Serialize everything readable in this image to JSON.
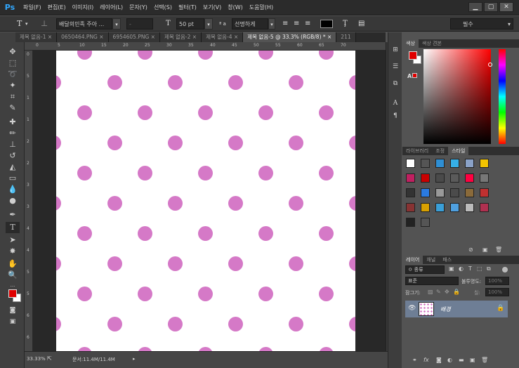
{
  "app": {
    "logo": "Ps",
    "window_controls": [
      "▁",
      "▢",
      "✕"
    ]
  },
  "menu": [
    "파일(F)",
    "편집(E)",
    "이미지(I)",
    "레이어(L)",
    "문자(Y)",
    "선택(S)",
    "필터(T)",
    "보기(V)",
    "창(W)",
    "도움말(H)"
  ],
  "options": {
    "font_family": "배달의민족 주아 ...",
    "font_style": "-",
    "font_size": "50 pt",
    "aa_label": "ª a",
    "anti_alias": "선명하게",
    "workspace": "필수",
    "text_color": "#000000"
  },
  "tabs": [
    {
      "label": "제목 없음-1 ×",
      "active": false
    },
    {
      "label": "0650464.PNG ×",
      "active": false
    },
    {
      "label": "6954605.PNG ×",
      "active": false
    },
    {
      "label": "제목 없음-2 ×",
      "active": false
    },
    {
      "label": "제목 없음-4 ×",
      "active": false
    },
    {
      "label": "제목 없음-5 @ 33.3% (RGB/8) * ×",
      "active": true
    },
    {
      "label": "211",
      "active": false
    }
  ],
  "ruler_h": [
    "0",
    "5",
    "10",
    "15",
    "20",
    "25",
    "30",
    "35",
    "40",
    "45",
    "50",
    "55",
    "60",
    "65",
    "70"
  ],
  "ruler_v": [
    "0",
    "5",
    "1",
    "1",
    "2",
    "2",
    "3",
    "3",
    "4",
    "4",
    "5",
    "5",
    "6",
    "6",
    "7"
  ],
  "status": {
    "zoom": "33.33%",
    "doc": "문서:11.4M/11.4M"
  },
  "color_panel": {
    "tabs": [
      "색상",
      "색상 견본"
    ],
    "foreground": "#e00000",
    "background": "#ffffff"
  },
  "styles_panel": {
    "tabs": [
      "라이브러리",
      "조정",
      "스타일"
    ]
  },
  "layers_panel": {
    "tabs": [
      "레이어",
      "채널",
      "패스"
    ],
    "filter": "ㅇ 종류",
    "blend_mode": "표준",
    "opacity_label": "불투명도:",
    "opacity_value": "100%",
    "lock_label": "잠그기:",
    "fill_label": "칠:",
    "fill_value": "100%",
    "layer_name": "배경"
  },
  "colors": {
    "dot": "#d579c7",
    "canvas": "#ffffff",
    "accent": "#31a8ff"
  }
}
